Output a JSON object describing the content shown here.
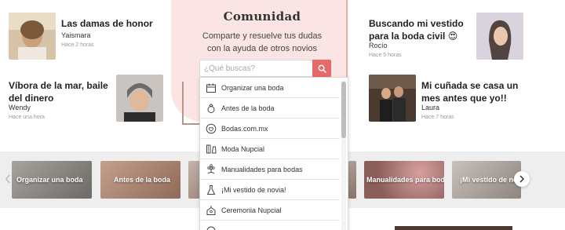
{
  "community": {
    "title": "Comunidad",
    "subtitle": "Comparte y resuelve tus dudas con la ayuda de otros novios",
    "search_placeholder": "¿Qué buscas?"
  },
  "questions": [
    {
      "title": "Las damas de honor",
      "author": "Yaismara",
      "time": "Hace 2 horas"
    },
    {
      "title": "Víbora de la mar, baile del dinero",
      "author": "Wendy",
      "time": "Hace una hora"
    },
    {
      "title": "Buscando mi vestido para la boda civil 😍",
      "author": "Rocío",
      "time": "Hace 5 horas"
    },
    {
      "title": "Mi cuñada se casa un mes antes que yo!!",
      "author": "Laura",
      "time": "Hace 7 horas"
    }
  ],
  "dropdown": {
    "items": [
      {
        "label": "Organizar una boda",
        "icon": "calendar-icon"
      },
      {
        "label": "Antes de la boda",
        "icon": "ring-icon"
      },
      {
        "label": "Bodas.com.mx",
        "icon": "heart-icon"
      },
      {
        "label": "Moda Nupcial",
        "icon": "suit-icon"
      },
      {
        "label": "Manualidades para bodas",
        "icon": "flower-icon"
      },
      {
        "label": "¡Mi vestido de novia!",
        "icon": "dress-icon"
      },
      {
        "label": "Ceremonia Nupcial",
        "icon": "church-icon"
      },
      {
        "label": "",
        "icon": "more-icon"
      }
    ]
  },
  "categories": [
    {
      "label": "Organizar una boda",
      "color": "#8a8480"
    },
    {
      "label": "Antes de la boda",
      "color": "#a78676"
    },
    {
      "label": "",
      "color": "#b5a39a"
    },
    {
      "label": "",
      "color": "#9b8a80"
    },
    {
      "label": "Manualidades para bodas",
      "color": "#8f6e6a"
    },
    {
      "label": "¡Mi vestido de no",
      "color": "#a79e98"
    }
  ],
  "colors": {
    "accent": "#e56a6a",
    "panel": "#fbe5e4",
    "strip": "#eeeeee"
  }
}
